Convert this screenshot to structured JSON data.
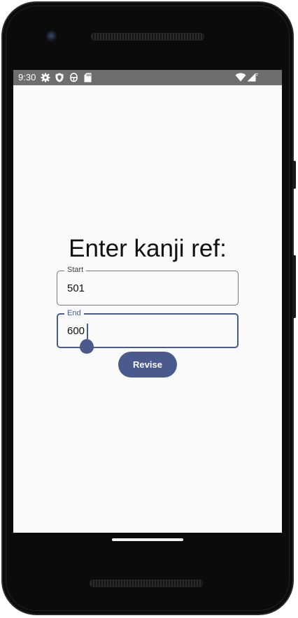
{
  "status_bar": {
    "time": "9:30",
    "left_icons": [
      "gear-icon",
      "shield-icon",
      "usb-debug-icon",
      "sd-card-icon"
    ],
    "right_icons": [
      "wifi-icon",
      "cell-signal-icon"
    ]
  },
  "screen": {
    "title": "Enter kanji ref:",
    "start_field": {
      "label": "Start",
      "value": "501"
    },
    "end_field": {
      "label": "End",
      "value": "600"
    },
    "revise_button": {
      "label": "Revise"
    }
  },
  "colors": {
    "accent": "#4a5a8c",
    "status_bar": "#6e6e6e",
    "screen_bg": "#fafafa",
    "device_frame": "#0b0b0b"
  }
}
